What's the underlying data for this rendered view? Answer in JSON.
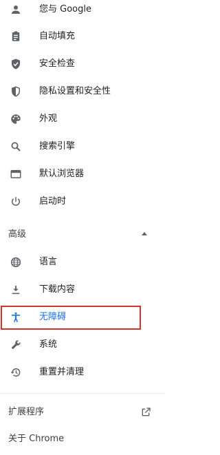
{
  "nav": {
    "items": [
      {
        "label": "您与 Google",
        "icon": "person-icon"
      },
      {
        "label": "自动填充",
        "icon": "clipboard-icon"
      },
      {
        "label": "安全检查",
        "icon": "shield-check-icon"
      },
      {
        "label": "隐私设置和安全性",
        "icon": "privacy-shield-icon"
      },
      {
        "label": "外观",
        "icon": "palette-icon"
      },
      {
        "label": "搜索引擎",
        "icon": "search-icon"
      },
      {
        "label": "默认浏览器",
        "icon": "browser-window-icon"
      },
      {
        "label": "启动时",
        "icon": "power-icon"
      }
    ],
    "advanced": {
      "label": "高级",
      "expanded": true,
      "items": [
        {
          "label": "语言",
          "icon": "globe-icon"
        },
        {
          "label": "下载内容",
          "icon": "download-icon"
        },
        {
          "label": "无障碍",
          "icon": "accessibility-icon",
          "active": true
        },
        {
          "label": "系统",
          "icon": "wrench-icon"
        },
        {
          "label": "重置并清理",
          "icon": "history-reset-icon"
        }
      ]
    },
    "extensions_label": "扩展程序",
    "about_label": "关于 Chrome"
  },
  "colors": {
    "icon": "#5f6368",
    "active": "#1a73e8",
    "highlight_border": "#d93025",
    "text": "#202124"
  }
}
